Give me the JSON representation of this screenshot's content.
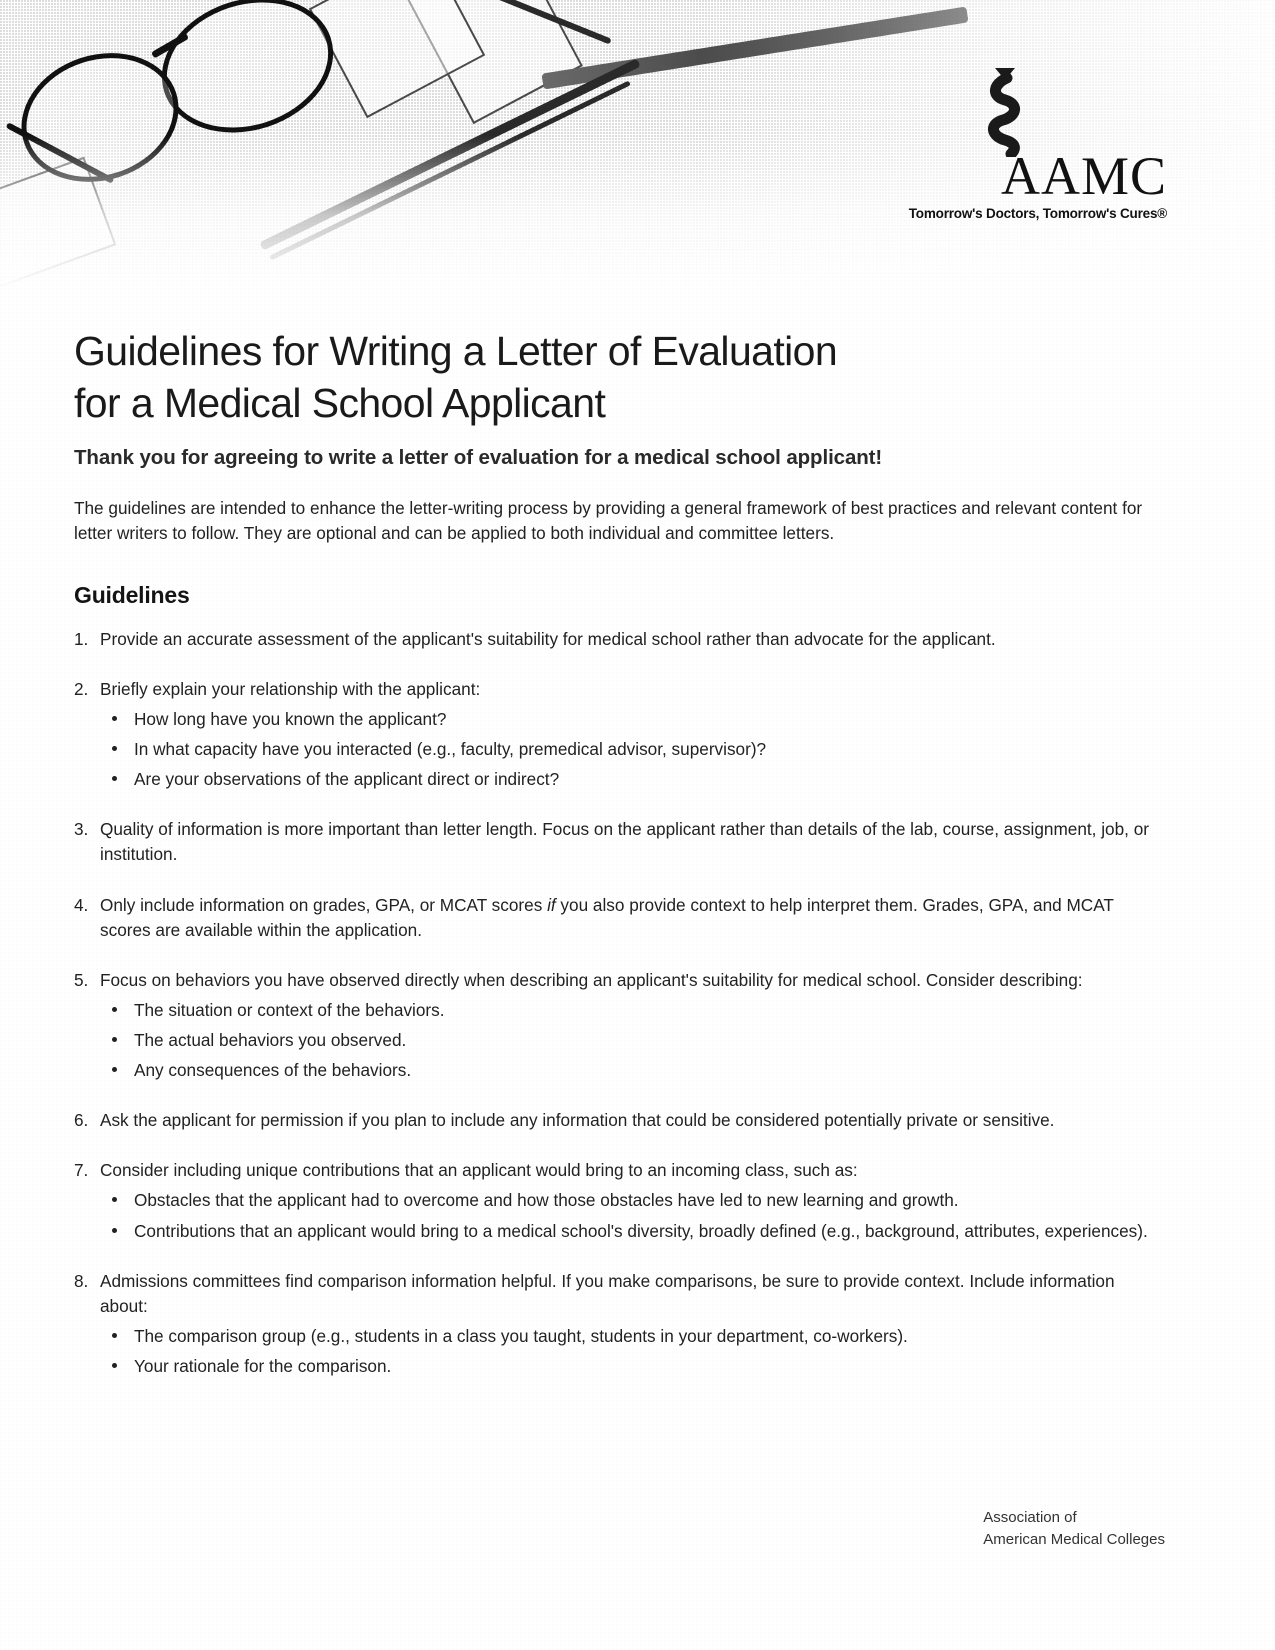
{
  "logo": {
    "wordmark": "AAMC",
    "tagline": "Tomorrow's Doctors, Tomorrow's Cures®",
    "serpent_icon": "serpent-rod-icon"
  },
  "header_image": {
    "alt": "Photo of eyeglasses, pens and notebook paper"
  },
  "document": {
    "title_line_1": "Guidelines for Writing a Letter of Evaluation",
    "title_line_2": "for a Medical School Applicant",
    "subtitle": "Thank you for agreeing to write a letter of evaluation for a medical school applicant!",
    "intro": "The guidelines are intended to enhance the letter-writing process by providing a general framework of best practices and relevant content for letter writers to follow. They are optional and can be applied to both individual and committee letters.",
    "section_heading": "Guidelines",
    "items": [
      {
        "number": "1.",
        "text": "Provide an accurate assessment of the applicant's suitability for medical school rather than advocate for the applicant.",
        "bullets": []
      },
      {
        "number": "2.",
        "text": "Briefly explain your relationship with the applicant:",
        "bullets": [
          "How long have you known the applicant?",
          "In what capacity have you interacted (e.g., faculty, premedical advisor, supervisor)?",
          "Are your observations of the applicant direct or indirect?"
        ]
      },
      {
        "number": "3.",
        "text": "Quality of information is more important than letter length. Focus on the applicant rather than details of the lab, course, assignment, job, or institution.",
        "bullets": []
      },
      {
        "number": "4.",
        "text_before_em": "Only include information on grades, GPA, or MCAT scores ",
        "em": "if",
        "text_after_em": " you also provide context to help interpret them. Grades, GPA, and MCAT scores are available within the application.",
        "bullets": []
      },
      {
        "number": "5.",
        "text": "Focus on behaviors you have observed directly when describing an applicant's suitability for medical school. Consider describing:",
        "bullets": [
          "The situation or context of the behaviors.",
          "The actual behaviors you observed.",
          "Any consequences of the behaviors."
        ]
      },
      {
        "number": "6.",
        "text": "Ask the applicant for permission if you plan to include any information that could be considered potentially private or sensitive.",
        "bullets": []
      },
      {
        "number": "7.",
        "text": "Consider including unique contributions that an applicant would bring to an incoming class, such as:",
        "bullets": [
          "Obstacles that the applicant had to overcome and how those obstacles have led to new learning and growth.",
          "Contributions that an applicant would bring to a medical school's diversity, broadly defined (e.g., background, attributes, experiences)."
        ]
      },
      {
        "number": "8.",
        "text": "Admissions committees find comparison information helpful. If you make comparisons, be sure to provide context. Include information about:",
        "bullets": [
          "The comparison group (e.g., students in a class you taught, students in your department, co-workers).",
          "Your rationale for the comparison."
        ]
      }
    ]
  },
  "footer": {
    "line_1": "Association of",
    "line_2": "American Medical Colleges"
  },
  "colors": {
    "ink": "#1c1c1c",
    "body_text": "#222222",
    "page_background": "#ffffff"
  }
}
